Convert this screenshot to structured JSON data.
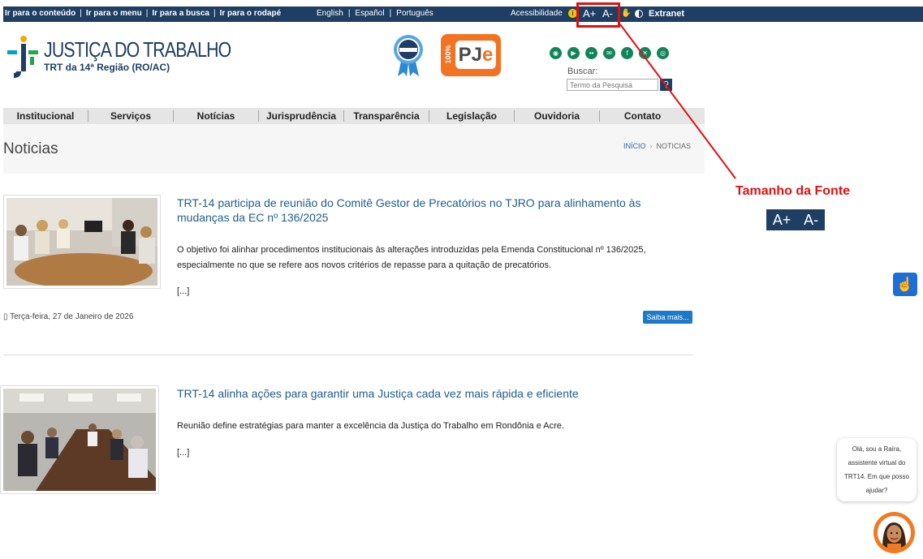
{
  "topbar": {
    "skip_links": [
      "Ir para o conteúdo",
      "Ir para o menu",
      "Ir para a busca",
      "Ir para o rodapé"
    ],
    "languages": [
      "English",
      "Español",
      "Português"
    ],
    "accessibility_label": "Acessibilidade",
    "font_increase": "A+",
    "font_decrease": "A-",
    "extranet": "Extranet"
  },
  "header": {
    "title": "JUSTIÇA DO TRABALHO",
    "subtitle": "TRT da 14ª Região (RO/AC)",
    "pje": {
      "percent": "100%",
      "pj": "PJ",
      "e": "e"
    },
    "social_icons": [
      "rss-icon",
      "youtube-icon",
      "flickr-icon",
      "email-icon",
      "facebook-icon",
      "x-icon",
      "instagram-icon"
    ],
    "search": {
      "label": "Buscar:",
      "placeholder": "Termo da Pesquisa"
    }
  },
  "nav": [
    "Institucional",
    "Serviços",
    "Notícias",
    "Jurisprudência",
    "Transparência",
    "Legislação",
    "Ouvidoria",
    "Contato"
  ],
  "page": {
    "title": "Noticias",
    "breadcrumb_home": "INÍCIO",
    "breadcrumb_current": "NOTICIAS"
  },
  "articles": [
    {
      "title": "TRT-14 participa de reunião do Comitê Gestor de Precatórios no TJRO para alinhamento às mudanças da EC nº 136/2025",
      "summary": "O objetivo foi alinhar procedimentos institucionais às alterações introduzidas pela Emenda Constitucional nº 136/2025, especialmente no que se refere aos novos critérios de repasse para a quitação de precatórios.",
      "more": "[...]",
      "date": "Terça-feira, 27 de Janeiro de 2026",
      "button": "Saiba mais..."
    },
    {
      "title": "TRT-14 alinha ações para garantir uma Justiça cada vez mais rápida e eficiente",
      "summary": "Reunião define estratégias para manter a excelência da Justiça do Trabalho em Rondônia e Acre.",
      "more": "[...]"
    }
  ],
  "annotation": {
    "label": "Tamanho da Fonte",
    "badge_plus": "A+",
    "badge_minus": "A-",
    "color": "#e01010"
  },
  "chat": {
    "message": "Olá, sou a Raíra, assistente virtual do TRT14. Em que posso ajudar?"
  },
  "colors": {
    "primary": "#1f3e63",
    "pje_orange": "#f47322",
    "social_green": "#11845a",
    "link_blue": "#1f5d8c",
    "button_blue": "#1d7ac8"
  }
}
